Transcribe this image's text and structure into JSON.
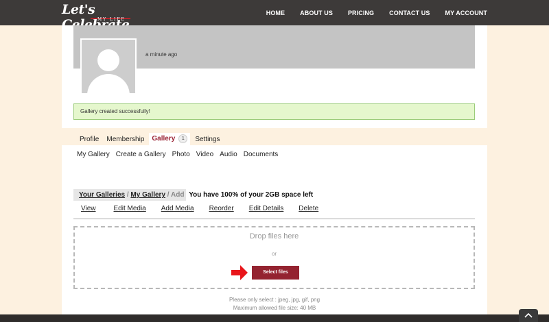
{
  "header": {
    "logo_main": "Let's Celebrate",
    "logo_sub": "MY LIFE",
    "nav": [
      "HOME",
      "ABOUT US",
      "PRICING",
      "CONTACT US",
      "MY ACCOUNT"
    ]
  },
  "profile": {
    "time": "a minute ago",
    "alert": "Gallery created successfully!"
  },
  "tabs": {
    "profile": "Profile",
    "membership": "Membership",
    "gallery": "Gallery",
    "gallery_count": "1",
    "settings": "Settings"
  },
  "subnav": [
    "My Gallery",
    "Create a Gallery",
    "Photo",
    "Video",
    "Audio",
    "Documents"
  ],
  "breadcrumb": {
    "your_galleries": "Your Galleries",
    "sep1": " / ",
    "my_gallery": "My Gallery",
    "sep2": " / ",
    "current": "Add",
    "space_text": "You have 100% of your 2GB space left"
  },
  "actions": [
    "View",
    "Edit Media",
    "Add Media",
    "Reorder",
    "Edit Details",
    "Delete"
  ],
  "dropzone": {
    "title": "Drop files here",
    "or": "or",
    "button": "Select files"
  },
  "hints": {
    "types": "Please only select : jpeg, jpg, gif, png",
    "size": "Maximum allowed file size: 40 MB"
  },
  "colors": {
    "header_bg": "#3d3a39",
    "accent": "#942330",
    "page_bg": "#fdf1e0",
    "alert_bg": "#e5f7cd",
    "arrow": "#e8161b"
  }
}
